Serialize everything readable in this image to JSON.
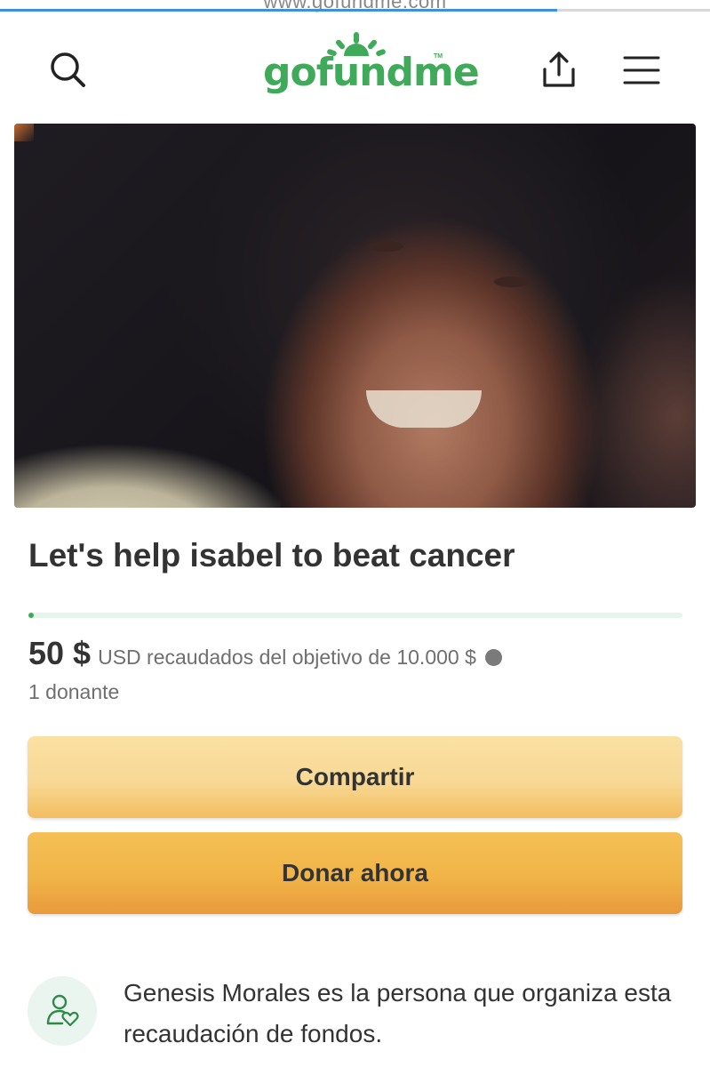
{
  "browser": {
    "url_text": "www.gofundme.com",
    "load_progress": 0.785
  },
  "header": {
    "logo_text": "gofundme",
    "logo_tm": "TM",
    "icons": [
      "search-icon",
      "share-upload-icon",
      "hamburger-menu-icon"
    ]
  },
  "campaign": {
    "title": "Let's help isabel to beat cancer",
    "raised_amount": "50 $",
    "raised_desc": "USD recaudados del objetivo de 10.000 $",
    "progress_fraction": 0.005,
    "donors": "1 donante"
  },
  "buttons": {
    "share_label": "Compartir",
    "donate_label": "Donar ahora"
  },
  "organizer": {
    "text": "Genesis Morales es la persona que organiza esta recaudación de fondos."
  },
  "colors": {
    "brand_green": "#3fab5a",
    "share_button": "#f8d996",
    "donate_button": "#f1b447"
  }
}
